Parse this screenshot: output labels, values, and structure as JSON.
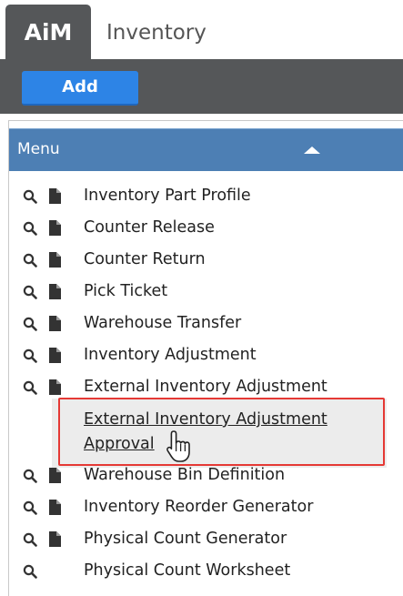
{
  "app": {
    "logo": "AiM",
    "module_tab": "Inventory"
  },
  "toolbar": {
    "add_label": "Add"
  },
  "menu": {
    "header": "Menu",
    "items": [
      {
        "label": "Inventory Part Profile",
        "has_search": true,
        "has_doc": true
      },
      {
        "label": "Counter Release",
        "has_search": true,
        "has_doc": true
      },
      {
        "label": "Counter Return",
        "has_search": true,
        "has_doc": true
      },
      {
        "label": "Pick Ticket",
        "has_search": true,
        "has_doc": true
      },
      {
        "label": "Warehouse Transfer",
        "has_search": true,
        "has_doc": true
      },
      {
        "label": "Inventory Adjustment",
        "has_search": true,
        "has_doc": true
      },
      {
        "label": "External Inventory Adjustment",
        "has_search": true,
        "has_doc": true
      },
      {
        "label": "External Inventory Adjustment Approval",
        "has_search": false,
        "has_doc": false,
        "highlighted": true
      },
      {
        "label": "Warehouse Bin Definition",
        "has_search": true,
        "has_doc": true
      },
      {
        "label": "Inventory Reorder Generator",
        "has_search": true,
        "has_doc": true
      },
      {
        "label": "Physical Count Generator",
        "has_search": true,
        "has_doc": true
      },
      {
        "label": "Physical Count Worksheet",
        "has_search": true,
        "has_doc": false
      }
    ]
  },
  "colors": {
    "header_bar": "#555759",
    "add_button": "#2d84e6",
    "menu_header": "#4d7fb4",
    "highlight_border": "#e53935"
  },
  "icons": {
    "search": "search-icon",
    "document": "document-icon",
    "collapse": "chevron-up-icon",
    "cursor": "hand-pointer-icon"
  }
}
